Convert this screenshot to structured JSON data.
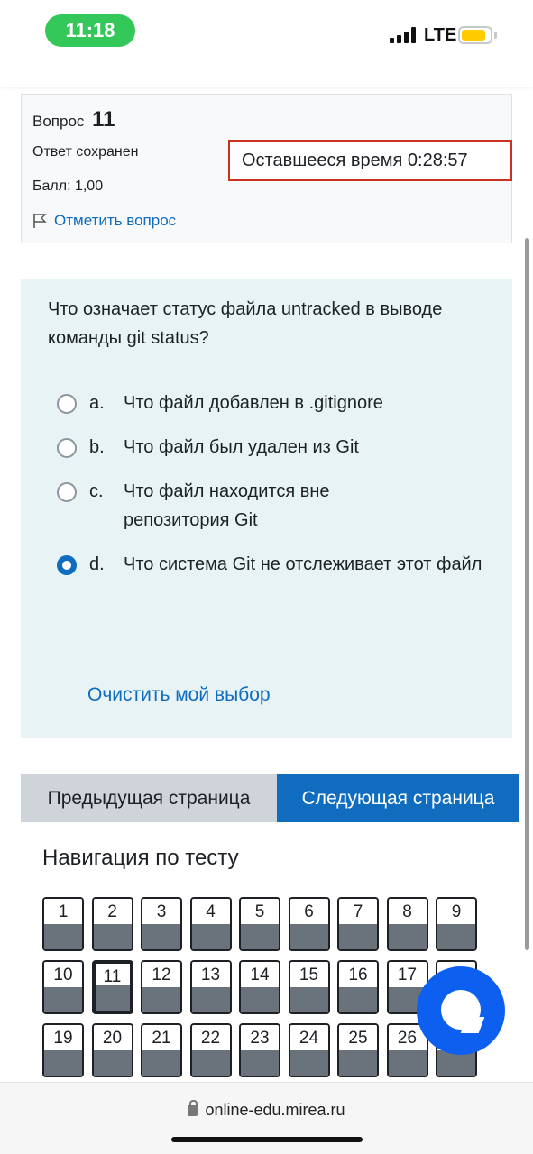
{
  "status_bar": {
    "time": "11:18",
    "network": "LTE",
    "icons": [
      "signal-icon",
      "battery-icon"
    ],
    "battery_color": "#ffcc00",
    "time_pill_color": "#34c759"
  },
  "question_info": {
    "label": "Вопрос",
    "number": "11",
    "state": "Ответ сохранен",
    "grade": "Балл: 1,00",
    "flag_label": "Отметить вопрос",
    "flag_icon": "flag-icon"
  },
  "timer": {
    "text": "Оставшееся время 0:28:57"
  },
  "question": {
    "text": "Что означает статус файла untracked в выводе команды git status?",
    "answers": [
      {
        "letter": "a.",
        "text": "Что файл добавлен в .gitignore",
        "selected": false
      },
      {
        "letter": "b.",
        "text": "Что файл был удален из Git",
        "selected": false
      },
      {
        "letter": "c.",
        "text": "Что файл находится вне репозитория Git",
        "selected": false
      },
      {
        "letter": "d.",
        "text": "Что система Git не отслеживает этот файл",
        "selected": true
      }
    ],
    "clear_label": "Очистить мой выбор"
  },
  "page_buttons": {
    "prev": "Предыдущая страница",
    "next": "Следующая страница"
  },
  "navigation": {
    "title": "Навигация по тесту",
    "current": "11",
    "items": [
      "1",
      "2",
      "3",
      "4",
      "5",
      "6",
      "7",
      "8",
      "9",
      "10",
      "11",
      "12",
      "13",
      "14",
      "15",
      "16",
      "17",
      "18",
      "19",
      "20",
      "21",
      "22",
      "23",
      "24",
      "25",
      "26",
      "27"
    ]
  },
  "chat": {
    "icon": "chat-bubble-icon"
  },
  "browser": {
    "url": "online-edu.mirea.ru",
    "lock_icon": "lock-icon"
  },
  "colors": {
    "accent": "#0f6cbf",
    "timer_border": "#ca3120",
    "question_bg": "#e7f3f5",
    "answered_fill": "#6a737b",
    "chat": "#0d5ff0"
  }
}
